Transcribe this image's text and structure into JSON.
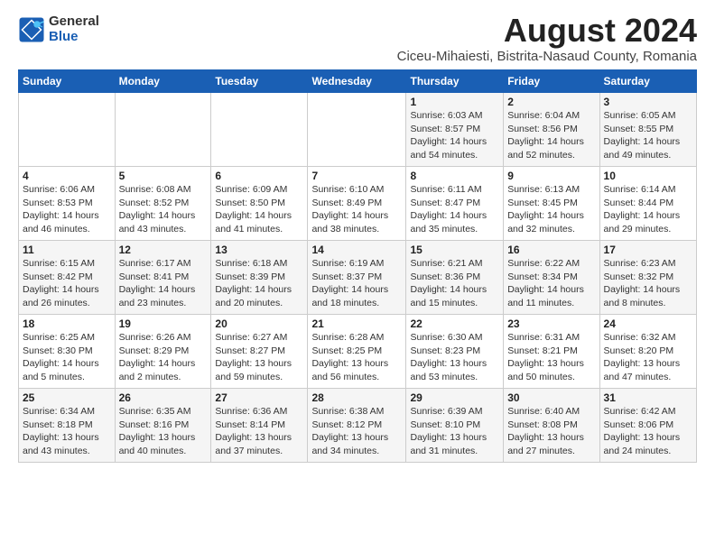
{
  "header": {
    "logo_general": "General",
    "logo_blue": "Blue",
    "title": "August 2024",
    "location": "Ciceu-Mihaiesti, Bistrita-Nasaud County, Romania"
  },
  "days_of_week": [
    "Sunday",
    "Monday",
    "Tuesday",
    "Wednesday",
    "Thursday",
    "Friday",
    "Saturday"
  ],
  "weeks": [
    [
      {
        "day": "",
        "info": ""
      },
      {
        "day": "",
        "info": ""
      },
      {
        "day": "",
        "info": ""
      },
      {
        "day": "",
        "info": ""
      },
      {
        "day": "1",
        "info": "Sunrise: 6:03 AM\nSunset: 8:57 PM\nDaylight: 14 hours\nand 54 minutes."
      },
      {
        "day": "2",
        "info": "Sunrise: 6:04 AM\nSunset: 8:56 PM\nDaylight: 14 hours\nand 52 minutes."
      },
      {
        "day": "3",
        "info": "Sunrise: 6:05 AM\nSunset: 8:55 PM\nDaylight: 14 hours\nand 49 minutes."
      }
    ],
    [
      {
        "day": "4",
        "info": "Sunrise: 6:06 AM\nSunset: 8:53 PM\nDaylight: 14 hours\nand 46 minutes."
      },
      {
        "day": "5",
        "info": "Sunrise: 6:08 AM\nSunset: 8:52 PM\nDaylight: 14 hours\nand 43 minutes."
      },
      {
        "day": "6",
        "info": "Sunrise: 6:09 AM\nSunset: 8:50 PM\nDaylight: 14 hours\nand 41 minutes."
      },
      {
        "day": "7",
        "info": "Sunrise: 6:10 AM\nSunset: 8:49 PM\nDaylight: 14 hours\nand 38 minutes."
      },
      {
        "day": "8",
        "info": "Sunrise: 6:11 AM\nSunset: 8:47 PM\nDaylight: 14 hours\nand 35 minutes."
      },
      {
        "day": "9",
        "info": "Sunrise: 6:13 AM\nSunset: 8:45 PM\nDaylight: 14 hours\nand 32 minutes."
      },
      {
        "day": "10",
        "info": "Sunrise: 6:14 AM\nSunset: 8:44 PM\nDaylight: 14 hours\nand 29 minutes."
      }
    ],
    [
      {
        "day": "11",
        "info": "Sunrise: 6:15 AM\nSunset: 8:42 PM\nDaylight: 14 hours\nand 26 minutes."
      },
      {
        "day": "12",
        "info": "Sunrise: 6:17 AM\nSunset: 8:41 PM\nDaylight: 14 hours\nand 23 minutes."
      },
      {
        "day": "13",
        "info": "Sunrise: 6:18 AM\nSunset: 8:39 PM\nDaylight: 14 hours\nand 20 minutes."
      },
      {
        "day": "14",
        "info": "Sunrise: 6:19 AM\nSunset: 8:37 PM\nDaylight: 14 hours\nand 18 minutes."
      },
      {
        "day": "15",
        "info": "Sunrise: 6:21 AM\nSunset: 8:36 PM\nDaylight: 14 hours\nand 15 minutes."
      },
      {
        "day": "16",
        "info": "Sunrise: 6:22 AM\nSunset: 8:34 PM\nDaylight: 14 hours\nand 11 minutes."
      },
      {
        "day": "17",
        "info": "Sunrise: 6:23 AM\nSunset: 8:32 PM\nDaylight: 14 hours\nand 8 minutes."
      }
    ],
    [
      {
        "day": "18",
        "info": "Sunrise: 6:25 AM\nSunset: 8:30 PM\nDaylight: 14 hours\nand 5 minutes."
      },
      {
        "day": "19",
        "info": "Sunrise: 6:26 AM\nSunset: 8:29 PM\nDaylight: 14 hours\nand 2 minutes."
      },
      {
        "day": "20",
        "info": "Sunrise: 6:27 AM\nSunset: 8:27 PM\nDaylight: 13 hours\nand 59 minutes."
      },
      {
        "day": "21",
        "info": "Sunrise: 6:28 AM\nSunset: 8:25 PM\nDaylight: 13 hours\nand 56 minutes."
      },
      {
        "day": "22",
        "info": "Sunrise: 6:30 AM\nSunset: 8:23 PM\nDaylight: 13 hours\nand 53 minutes."
      },
      {
        "day": "23",
        "info": "Sunrise: 6:31 AM\nSunset: 8:21 PM\nDaylight: 13 hours\nand 50 minutes."
      },
      {
        "day": "24",
        "info": "Sunrise: 6:32 AM\nSunset: 8:20 PM\nDaylight: 13 hours\nand 47 minutes."
      }
    ],
    [
      {
        "day": "25",
        "info": "Sunrise: 6:34 AM\nSunset: 8:18 PM\nDaylight: 13 hours\nand 43 minutes."
      },
      {
        "day": "26",
        "info": "Sunrise: 6:35 AM\nSunset: 8:16 PM\nDaylight: 13 hours\nand 40 minutes."
      },
      {
        "day": "27",
        "info": "Sunrise: 6:36 AM\nSunset: 8:14 PM\nDaylight: 13 hours\nand 37 minutes."
      },
      {
        "day": "28",
        "info": "Sunrise: 6:38 AM\nSunset: 8:12 PM\nDaylight: 13 hours\nand 34 minutes."
      },
      {
        "day": "29",
        "info": "Sunrise: 6:39 AM\nSunset: 8:10 PM\nDaylight: 13 hours\nand 31 minutes."
      },
      {
        "day": "30",
        "info": "Sunrise: 6:40 AM\nSunset: 8:08 PM\nDaylight: 13 hours\nand 27 minutes."
      },
      {
        "day": "31",
        "info": "Sunrise: 6:42 AM\nSunset: 8:06 PM\nDaylight: 13 hours\nand 24 minutes."
      }
    ]
  ]
}
